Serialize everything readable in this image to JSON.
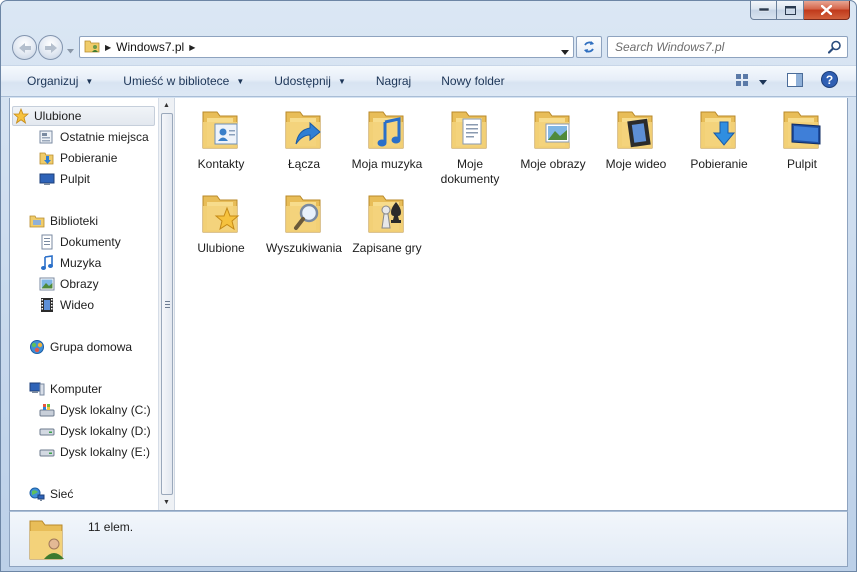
{
  "window": {
    "caption": {
      "minimize": "minimize",
      "maximize": "maximize",
      "close": "close"
    }
  },
  "address": {
    "path": "Windows7.pl",
    "search_placeholder": "Search Windows7.pl"
  },
  "toolbar": {
    "items": [
      {
        "label": "Organizuj",
        "dropdown": true
      },
      {
        "label": "Umieść w bibliotece",
        "dropdown": true
      },
      {
        "label": "Udostępnij",
        "dropdown": true
      },
      {
        "label": "Nagraj",
        "dropdown": false
      },
      {
        "label": "Nowy folder",
        "dropdown": false
      }
    ]
  },
  "sidebar": {
    "favorites": {
      "label": "Ulubione",
      "items": [
        "Ostatnie miejsca",
        "Pobieranie",
        "Pulpit"
      ]
    },
    "libraries": {
      "label": "Biblioteki",
      "items": [
        "Dokumenty",
        "Muzyka",
        "Obrazy",
        "Wideo"
      ]
    },
    "homegroup": {
      "label": "Grupa domowa"
    },
    "computer": {
      "label": "Komputer",
      "items": [
        "Dysk lokalny (C:)",
        "Dysk lokalny (D:)",
        "Dysk lokalny (E:)"
      ]
    },
    "network": {
      "label": "Sieć"
    }
  },
  "files": [
    {
      "label": "Kontakty",
      "overlay": "contacts-icon"
    },
    {
      "label": "Łącza",
      "overlay": "link-arrow-icon"
    },
    {
      "label": "Moja muzyka",
      "overlay": "music-note-icon"
    },
    {
      "label": "Moje dokumenty",
      "overlay": "document-icon"
    },
    {
      "label": "Moje obrazy",
      "overlay": "picture-icon"
    },
    {
      "label": "Moje wideo",
      "overlay": "film-icon"
    },
    {
      "label": "Pobieranie",
      "overlay": "download-arrow-icon"
    },
    {
      "label": "Pulpit",
      "overlay": "desktop-icon"
    },
    {
      "label": "Ulubione",
      "overlay": "star-icon"
    },
    {
      "label": "Wyszukiwania",
      "overlay": "magnifier-icon"
    },
    {
      "label": "Zapisane gry",
      "overlay": "chess-piece-icon"
    }
  ],
  "status": {
    "text": "11 elem."
  },
  "colors": {
    "frame": "#c7d8ec",
    "folder": "#f3d27a",
    "toolbar_text": "#1c3557",
    "close_button": "#c0391b"
  }
}
